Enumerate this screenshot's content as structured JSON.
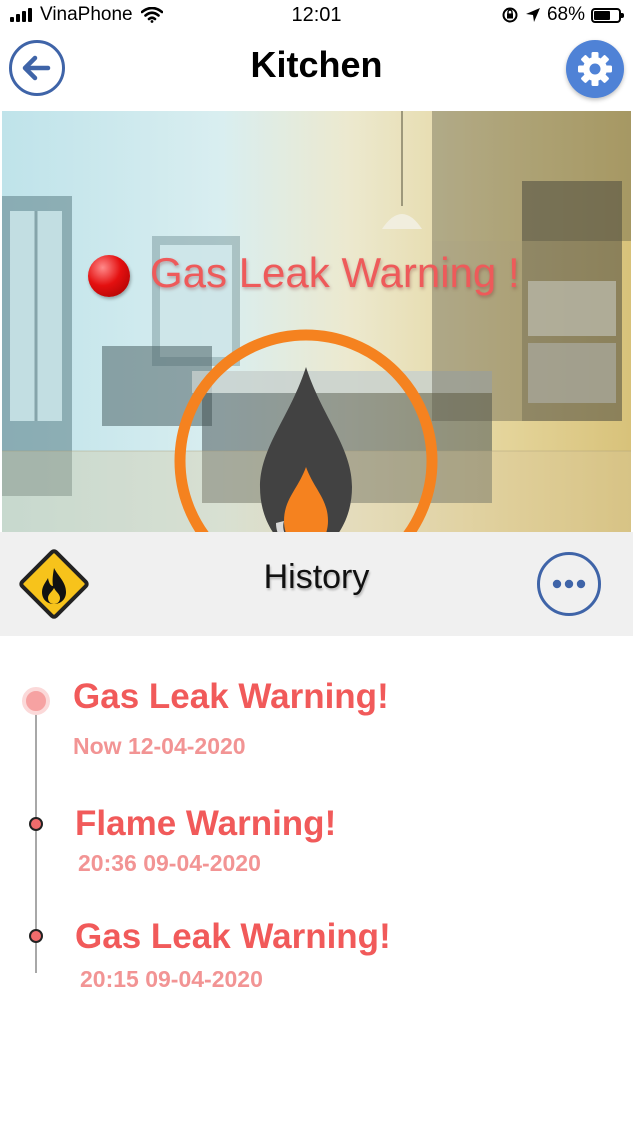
{
  "status_bar": {
    "carrier": "VinaPhone",
    "time": "12:01",
    "battery": "68%",
    "battery_level": 0.68,
    "icons": [
      "signal-bars-icon",
      "wifi-icon",
      "orientation-lock-icon",
      "location-arrow-icon",
      "battery-icon"
    ]
  },
  "header": {
    "title": "Kitchen",
    "back_icon": "arrow-left-icon",
    "settings_icon": "gear-icon"
  },
  "alert": {
    "title": "Gas Leak Warning !",
    "status_color": "#e41010",
    "emblem_icon": "gas-flame-icon",
    "accent_color": "#f5821f"
  },
  "history": {
    "title": "History",
    "hazard_icon": "flammable-hazard-icon",
    "more_icon": "ellipsis-icon",
    "events": [
      {
        "title": "Gas Leak Warning!",
        "date": "Now 12-04-2020"
      },
      {
        "title": "Flame Warning!",
        "date": "20:36 09-04-2020"
      },
      {
        "title": "Gas Leak Warning!",
        "date": "20:15 09-04-2020"
      }
    ]
  },
  "colors": {
    "primary_blue": "#3f64a8",
    "warning_red": "#f15a5a"
  }
}
